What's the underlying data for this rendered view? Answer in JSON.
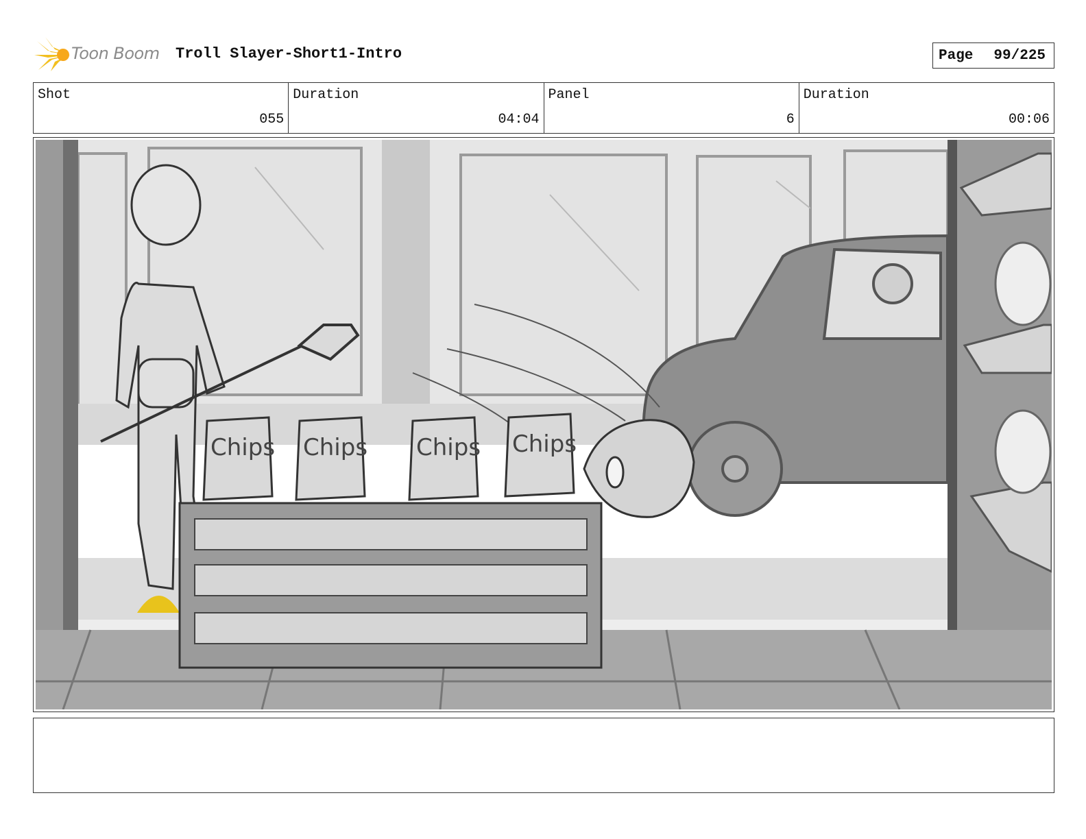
{
  "header": {
    "logo_text": "Toon Boom",
    "project_title": "Troll Slayer-Short1-Intro",
    "page_label": "Page",
    "page_value": "99/225"
  },
  "info": {
    "shot_label": "Shot",
    "shot_value": "055",
    "shot_duration_label": "Duration",
    "shot_duration_value": "04:04",
    "panel_label": "Panel",
    "panel_value": "6",
    "panel_duration_label": "Duration",
    "panel_duration_value": "00:06"
  },
  "panel_image": {
    "chips_bag_text": "Chips",
    "highlight_color": "#e8c31c"
  },
  "notes": {
    "dialogue": ""
  }
}
